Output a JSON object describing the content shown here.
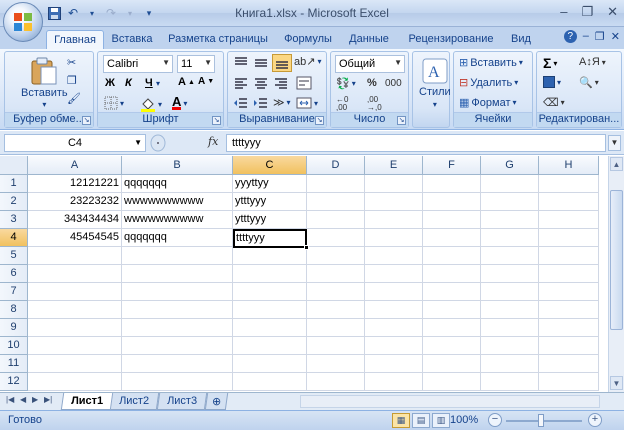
{
  "window": {
    "title": "Книга1.xlsx - Microsoft Excel",
    "minimize": "–",
    "restore": "❐",
    "close": "✕"
  },
  "qat": {
    "save_icon": "save-icon",
    "undo_icon": "undo-icon",
    "redo_icon": "redo-icon",
    "customize_icon": "chevron-down-icon"
  },
  "tabs": [
    "Главная",
    "Вставка",
    "Разметка страницы",
    "Формулы",
    "Данные",
    "Рецензирование",
    "Вид"
  ],
  "ribbon": {
    "clipboard": {
      "label": "Буфер обме...",
      "paste": "Вставить"
    },
    "font": {
      "label": "Шрифт",
      "name": "Calibri",
      "size": "11",
      "bold": "Ж",
      "italic": "К",
      "underline": "Ч"
    },
    "alignment": {
      "label": "Выравнивание"
    },
    "number": {
      "label": "Число",
      "format": "Общий",
      "percent": "%",
      "thousands": "000"
    },
    "styles": {
      "label": "Стили"
    },
    "cells": {
      "label": "Ячейки",
      "insert": "Вставить",
      "delete": "Удалить",
      "format": "Формат"
    },
    "editing": {
      "label": "Редактирован..."
    }
  },
  "formula_bar": {
    "name_box": "C4",
    "fx": "fx",
    "value": "ttttyyy"
  },
  "columns": [
    "A",
    "B",
    "C",
    "D",
    "E",
    "F",
    "G",
    "H"
  ],
  "selected_column": "C",
  "rows": [
    "1",
    "2",
    "3",
    "4",
    "5",
    "6",
    "7",
    "8",
    "9",
    "10",
    "11",
    "12"
  ],
  "selected_row": "4",
  "cells": [
    {
      "a": "12121221",
      "b": "qqqqqqq",
      "c": "yyyttyy"
    },
    {
      "a": "23223232",
      "b": "wwwwwwwwww",
      "c": "ytttyyy"
    },
    {
      "a": "343434434",
      "b": "wwwwwwwwww",
      "c": "ytttyyy"
    },
    {
      "a": "45454545",
      "b": "qqqqqqq",
      "c": "ttttyyy"
    }
  ],
  "sheets": [
    "Лист1",
    "Лист2",
    "Лист3"
  ],
  "active_sheet": "Лист1",
  "status": {
    "ready": "Готово",
    "zoom": "100%"
  }
}
